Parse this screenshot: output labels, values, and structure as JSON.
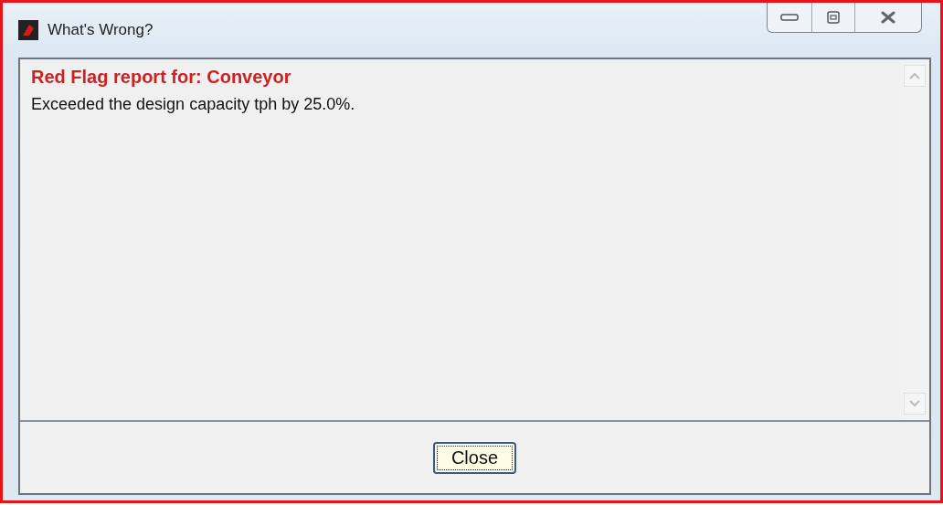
{
  "window": {
    "title": "What's Wrong?"
  },
  "report": {
    "heading": "Red Flag report for: Conveyor",
    "message": "Exceeded the design capacity tph by 25.0%."
  },
  "buttons": [
    {
      "label": "Close",
      "focused": true
    }
  ]
}
